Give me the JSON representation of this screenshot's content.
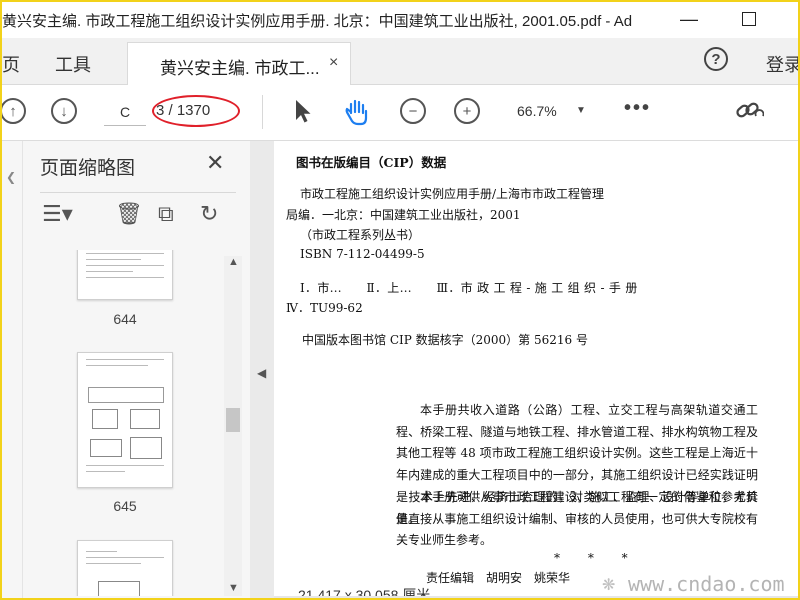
{
  "window": {
    "title": "黄兴安主编. 市政工程施工组织设计实例应用手册. 北京：中国建筑工业出版社, 2001.05.pdf - Ad",
    "minimize_glyph": "—"
  },
  "tabbar": {
    "pages_label": "页",
    "tools_label": "工具",
    "doc_tab_label": "黄兴安主编. 市政工...",
    "doc_tab_close": "×",
    "help_glyph": "?",
    "login_label": "登录"
  },
  "toolbar": {
    "prev_glyph": "↑",
    "next_glyph": "↓",
    "current_page": "C",
    "page_count": "3 / 1370",
    "zoom": "66.7%",
    "zoom_caret": "▼",
    "more": "•••"
  },
  "panel": {
    "title": "页面缩略图",
    "close_glyph": "✕",
    "options_glyph": "☰▾",
    "delete_glyph": "🗑",
    "extract_glyph": "⧉",
    "rotate_glyph": "↻",
    "scroll_up": "▲",
    "scroll_down": "▼",
    "thumbnails": [
      {
        "label": "644"
      },
      {
        "label": "645"
      },
      {
        "label": ""
      }
    ]
  },
  "document": {
    "cip_heading": "图书在版编目（CIP）数据",
    "line1": "市政工程施工组织设计实例应用手册/上海市市政工程管理",
    "line2": "局编．一北京：中国建筑工业出版社，2001",
    "line3": "（市政工程系列丛书）",
    "line4": "ISBN 7-112-04499-5",
    "line5": "Ⅰ．市…　　Ⅱ．上…　　Ⅲ．市 政 工 程 - 施 工 组 织 - 手 册",
    "line6": "Ⅳ．TU99-62",
    "line7": "中国版本图书馆 CIP 数据核字（2000）第 56216 号",
    "para1": "本手册共收入道路（公路）工程、立交工程与高架轨道交通工程、桥梁工程、隧道与地铁工程、排水管道工程、排水构筑物工程及其他工程等 48 项市政工程施工组织设计实例。这些工程是上海近十年内建成的重大工程项目中的一部分，其施工组织设计已经实践证明是技术上先进、经济上合理的，对类似工程有一定的借鉴和参考价值。",
    "para2": "本手册可供从事市政工程建设、施工、监理、设计等单位，尤其是直接从事施工组织设计编制、审核的人员使用，也可供大专院校有关专业师生参考。",
    "stars": "* * *",
    "editor_line": "责任编辑　胡明安　姚荣华",
    "page_size_status": "21.417 x 30.058 厘米"
  },
  "watermark": {
    "text": "www.cndao.com"
  },
  "colors": {
    "highlight_ellipse": "#e0202a",
    "hand_tool_active": "#1d7ef0",
    "frame_border": "#f2d21a"
  }
}
